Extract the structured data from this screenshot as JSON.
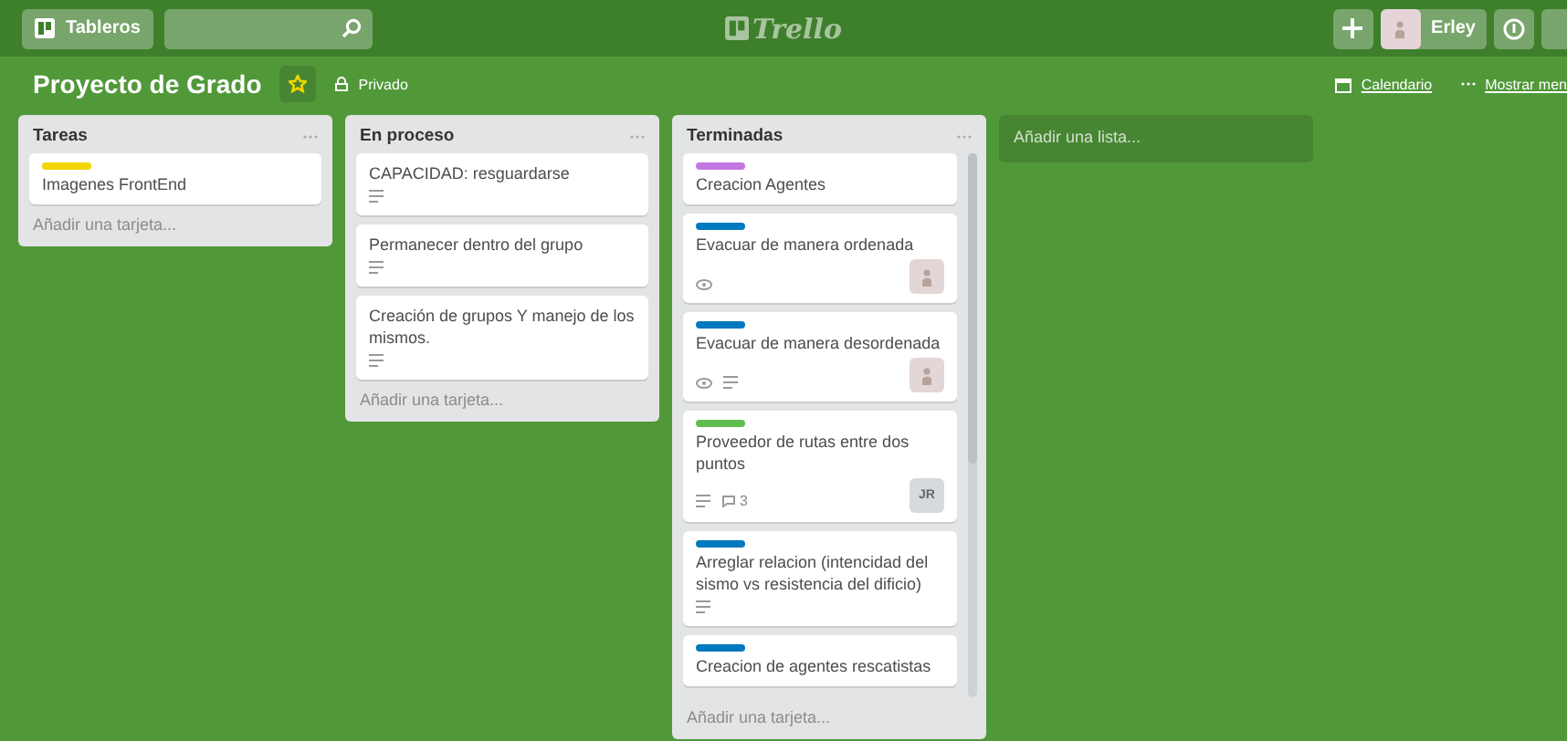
{
  "header": {
    "boards_button": "Tableros",
    "logo": "Trello",
    "user": {
      "name": "Erley"
    }
  },
  "board": {
    "title": "Proyecto de Grado",
    "starred": true,
    "visibility": "Privado",
    "calendar": "Calendario",
    "menu": "Mostrar men"
  },
  "lists": [
    {
      "title": "Tareas",
      "kind": "plain",
      "add_card": "Añadir una tarjeta...",
      "cards": [
        {
          "label": {
            "color": "#f2d600"
          },
          "title": "Imagenes FrontEnd"
        }
      ]
    },
    {
      "title": "En proceso",
      "kind": "plain",
      "add_card": "Añadir una tarjeta...",
      "cards": [
        {
          "title": "CAPACIDAD: resguardarse",
          "badges": [
            {
              "kind": "description"
            }
          ]
        },
        {
          "title": "Permanecer dentro del grupo",
          "badges": [
            {
              "kind": "description"
            }
          ]
        },
        {
          "title": "Creación de grupos Y manejo de los mismos.",
          "badges": [
            {
              "kind": "description"
            }
          ]
        }
      ]
    },
    {
      "title": "Terminadas",
      "kind": "scrolling",
      "add_card": "Añadir una tarjeta...",
      "cards": [
        {
          "label": {
            "color": "#c377e0"
          },
          "title": "Creacion Agentes"
        },
        {
          "label": {
            "color": "#0079bf"
          },
          "title": "Evacuar de manera ordenada",
          "badges": [
            {
              "kind": "watch"
            }
          ],
          "member": {
            "kind": "avatar"
          }
        },
        {
          "label": {
            "color": "#0079bf"
          },
          "title": "Evacuar de manera desordenada",
          "badges": [
            {
              "kind": "watch"
            },
            {
              "kind": "description"
            }
          ],
          "member": {
            "kind": "avatar"
          }
        },
        {
          "label": {
            "color": "#61bd4f"
          },
          "title": "Proveedor de rutas entre dos puntos",
          "badges": [
            {
              "kind": "description"
            },
            {
              "kind": "comments",
              "count": "3"
            }
          ],
          "member": {
            "kind": "initials",
            "initials": "JR"
          }
        },
        {
          "label": {
            "color": "#0079bf"
          },
          "title": "Arreglar relacion (intencidad del sismo vs resistencia del dificio)",
          "badges": [
            {
              "kind": "description"
            }
          ]
        },
        {
          "label": {
            "color": "#0079bf"
          },
          "title": "Creacion de agentes rescatistas"
        }
      ]
    }
  ],
  "add_list": "Añadir una lista..."
}
